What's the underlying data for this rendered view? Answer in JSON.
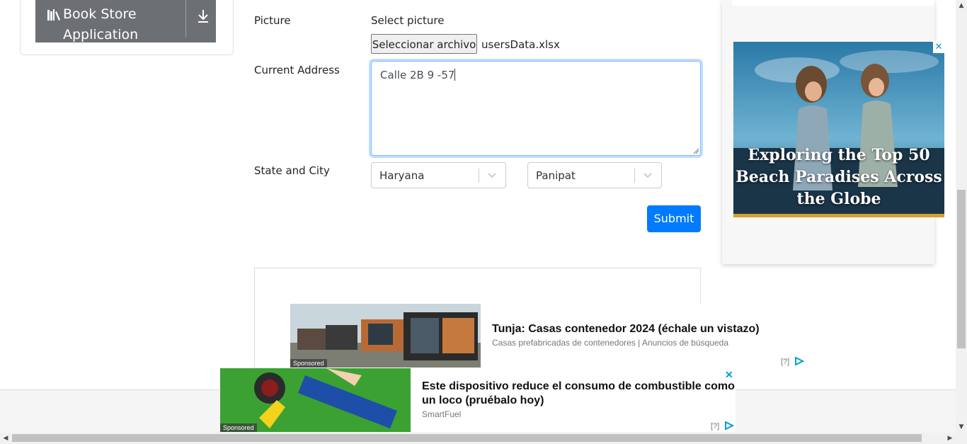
{
  "sidebar": {
    "item_label": "Book Store Application",
    "item_icon": "books-icon",
    "action_icon": "download-icon"
  },
  "form": {
    "picture_label": "Picture",
    "select_picture_label": "Select picture",
    "file_button": "Seleccionar archivo",
    "file_name": "usersData.xlsx",
    "address_label": "Current Address",
    "address_value": "Calle 2B 9 -57",
    "state_city_label": "State and City",
    "state_value": "Haryana",
    "city_value": "Panipat",
    "submit_label": "Submit"
  },
  "right_ad": {
    "headline": "Exploring the Top 50 Beach Paradises Across the Globe",
    "close_glyph": "✕"
  },
  "sponsored": [
    {
      "title": "Tunja: Casas contenedor 2024 (échale un vistazo)",
      "subtitle": "Casas prefabricadas de contenedores | Anuncios de búsqueda",
      "tag": "Sponsored",
      "mark": "[?]"
    },
    {
      "title": "Este dispositivo reduce el consumo de combustible como un loco (pruébalo hoy)",
      "subtitle": "SmartFuel",
      "tag": "Sponsored",
      "mark": "[?]",
      "close_glyph": "✕"
    }
  ],
  "colors": {
    "primary": "#007bff",
    "sidebar_item": "#6c7075",
    "focus": "#80bdff",
    "adchoices": "#00a2c8"
  }
}
